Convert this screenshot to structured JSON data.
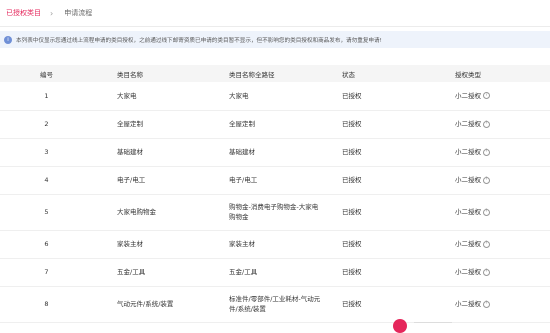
{
  "tabs": [
    {
      "label": "已授权类目",
      "active": true
    },
    {
      "label": "申请流程",
      "active": false
    }
  ],
  "tab_separator": "›",
  "notice": {
    "icon_glyph": "i",
    "text": "本列表中仅显示您通过线上流程申请的类目授权，之前通过线下邮寄资质已申请的类目暂不显示，但不影响您的类目授权和商品发布，请勿重复申请!"
  },
  "table": {
    "headers": [
      "编号",
      "类目名称",
      "类目名称全路径",
      "状态",
      "授权类型"
    ],
    "rows": [
      {
        "num": "1",
        "name": "大家电",
        "path": "大家电",
        "status": "已授权",
        "type": "小二授权"
      },
      {
        "num": "2",
        "name": "全屋定制",
        "path": "全屋定制",
        "status": "已授权",
        "type": "小二授权"
      },
      {
        "num": "3",
        "name": "基础建材",
        "path": "基础建材",
        "status": "已授权",
        "type": "小二授权"
      },
      {
        "num": "4",
        "name": "电子/电工",
        "path": "电子/电工",
        "status": "已授权",
        "type": "小二授权"
      },
      {
        "num": "5",
        "name": "大家电购物金",
        "path": "购物金-消费电子购物金-大家电购物金",
        "status": "已授权",
        "type": "小二授权"
      },
      {
        "num": "6",
        "name": "家装主材",
        "path": "家装主材",
        "status": "已授权",
        "type": "小二授权"
      },
      {
        "num": "7",
        "name": "五金/工具",
        "path": "五金/工具",
        "status": "已授权",
        "type": "小二授权"
      },
      {
        "num": "8",
        "name": "气动元件/系统/装置",
        "path": "标准件/零部件/工业耗材-气动元件/系统/装置",
        "status": "已授权",
        "type": "小二授权"
      }
    ],
    "help_icon_glyph": "?"
  },
  "colors": {
    "accent": "#e5265b",
    "notice_bg": "#eef3fb",
    "info_icon": "#6f8fd6",
    "header_bg": "#f5f5f5"
  }
}
